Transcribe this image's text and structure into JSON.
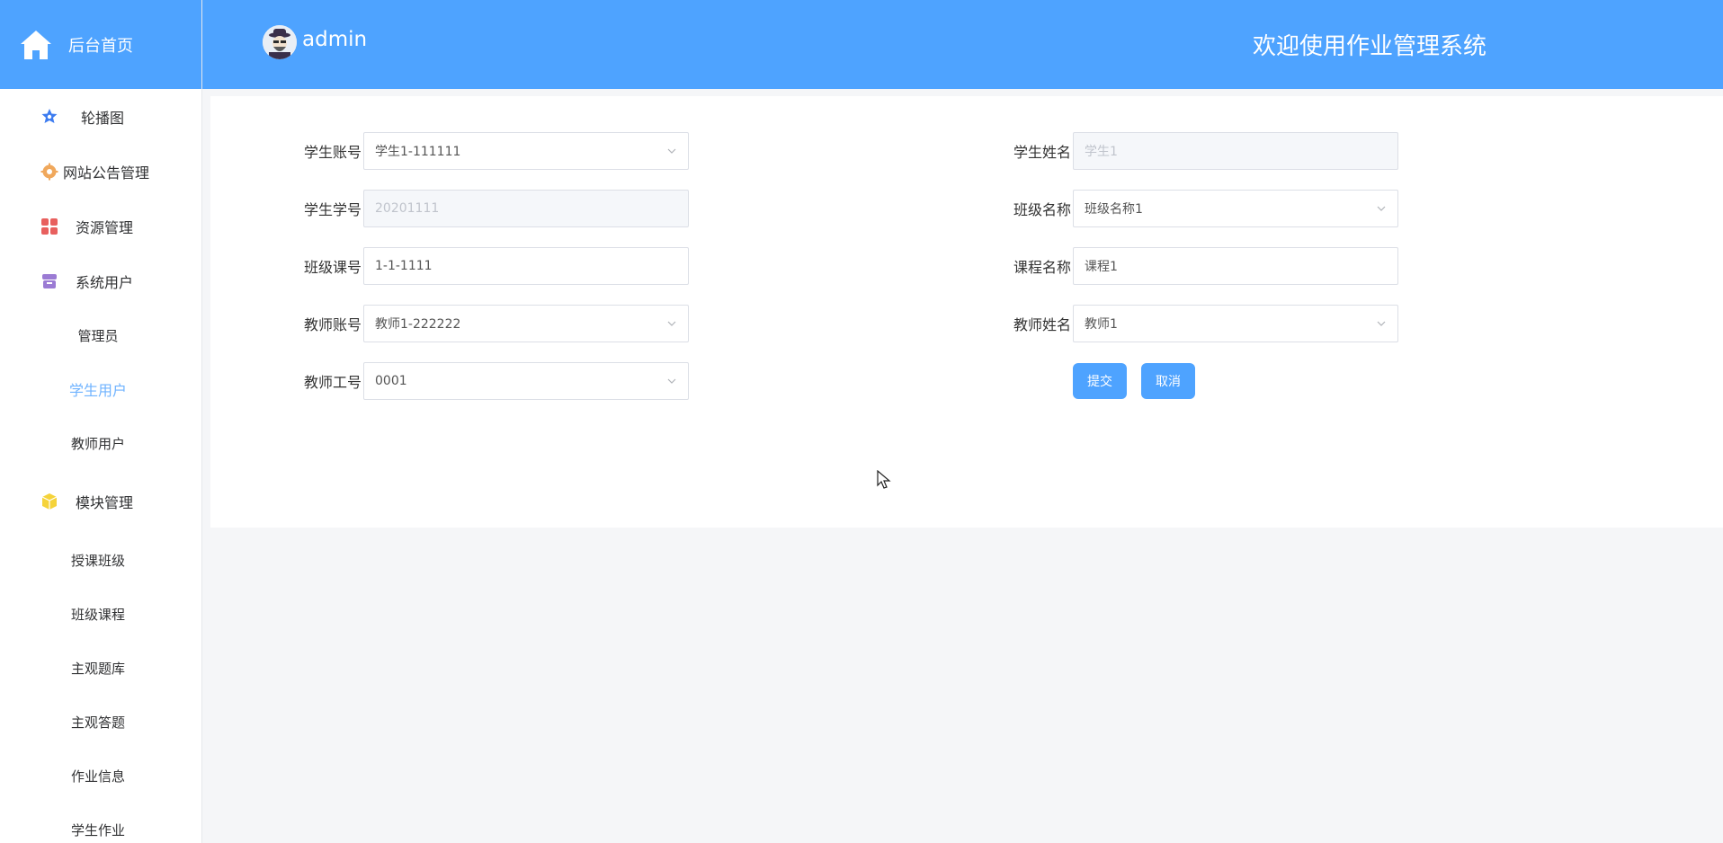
{
  "sidebar": {
    "brand_label": "后台首页",
    "menu": {
      "carousel": "轮播图",
      "notice": "网站公告管理",
      "resource": "资源管理",
      "system_users": "系统用户",
      "admin": "管理员",
      "student_users": "学生用户",
      "teacher_users": "教师用户",
      "modules": "模块管理",
      "teaching_class": "授课班级",
      "class_course": "班级课程",
      "subjective_bank": "主观题库",
      "subjective_answer": "主观答题",
      "homework_info": "作业信息",
      "student_homework": "学生作业"
    },
    "active_item": "学生用户"
  },
  "header": {
    "user_name": "admin",
    "system_title": "欢迎使用作业管理系统"
  },
  "form": {
    "student_account": {
      "label": "学生账号：",
      "value": "学生1-111111"
    },
    "student_name": {
      "label": "学生姓名：",
      "value": "学生1"
    },
    "student_number": {
      "label": "学生学号：",
      "value": "20201111"
    },
    "class_name": {
      "label": "班级名称：",
      "value": "班级名称1"
    },
    "class_course_no": {
      "label": "班级课号：",
      "value": "1-1-1111"
    },
    "course_name": {
      "label": "课程名称：",
      "value": "课程1"
    },
    "teacher_account": {
      "label": "教师账号：",
      "value": "教师1-222222"
    },
    "teacher_name": {
      "label": "教师姓名：",
      "value": "教师1"
    },
    "teacher_id": {
      "label": "教师工号：",
      "value": "0001"
    },
    "submit_label": "提交",
    "cancel_label": "取消"
  },
  "colors": {
    "primary": "#4ea3ff",
    "active_menu": "#6fb3ff",
    "icon_blue": "#3d7cf0",
    "icon_orange": "#f0a85c",
    "icon_red": "#e8605e",
    "icon_purple": "#9b7bd4",
    "icon_yellow": "#f5d33a"
  }
}
